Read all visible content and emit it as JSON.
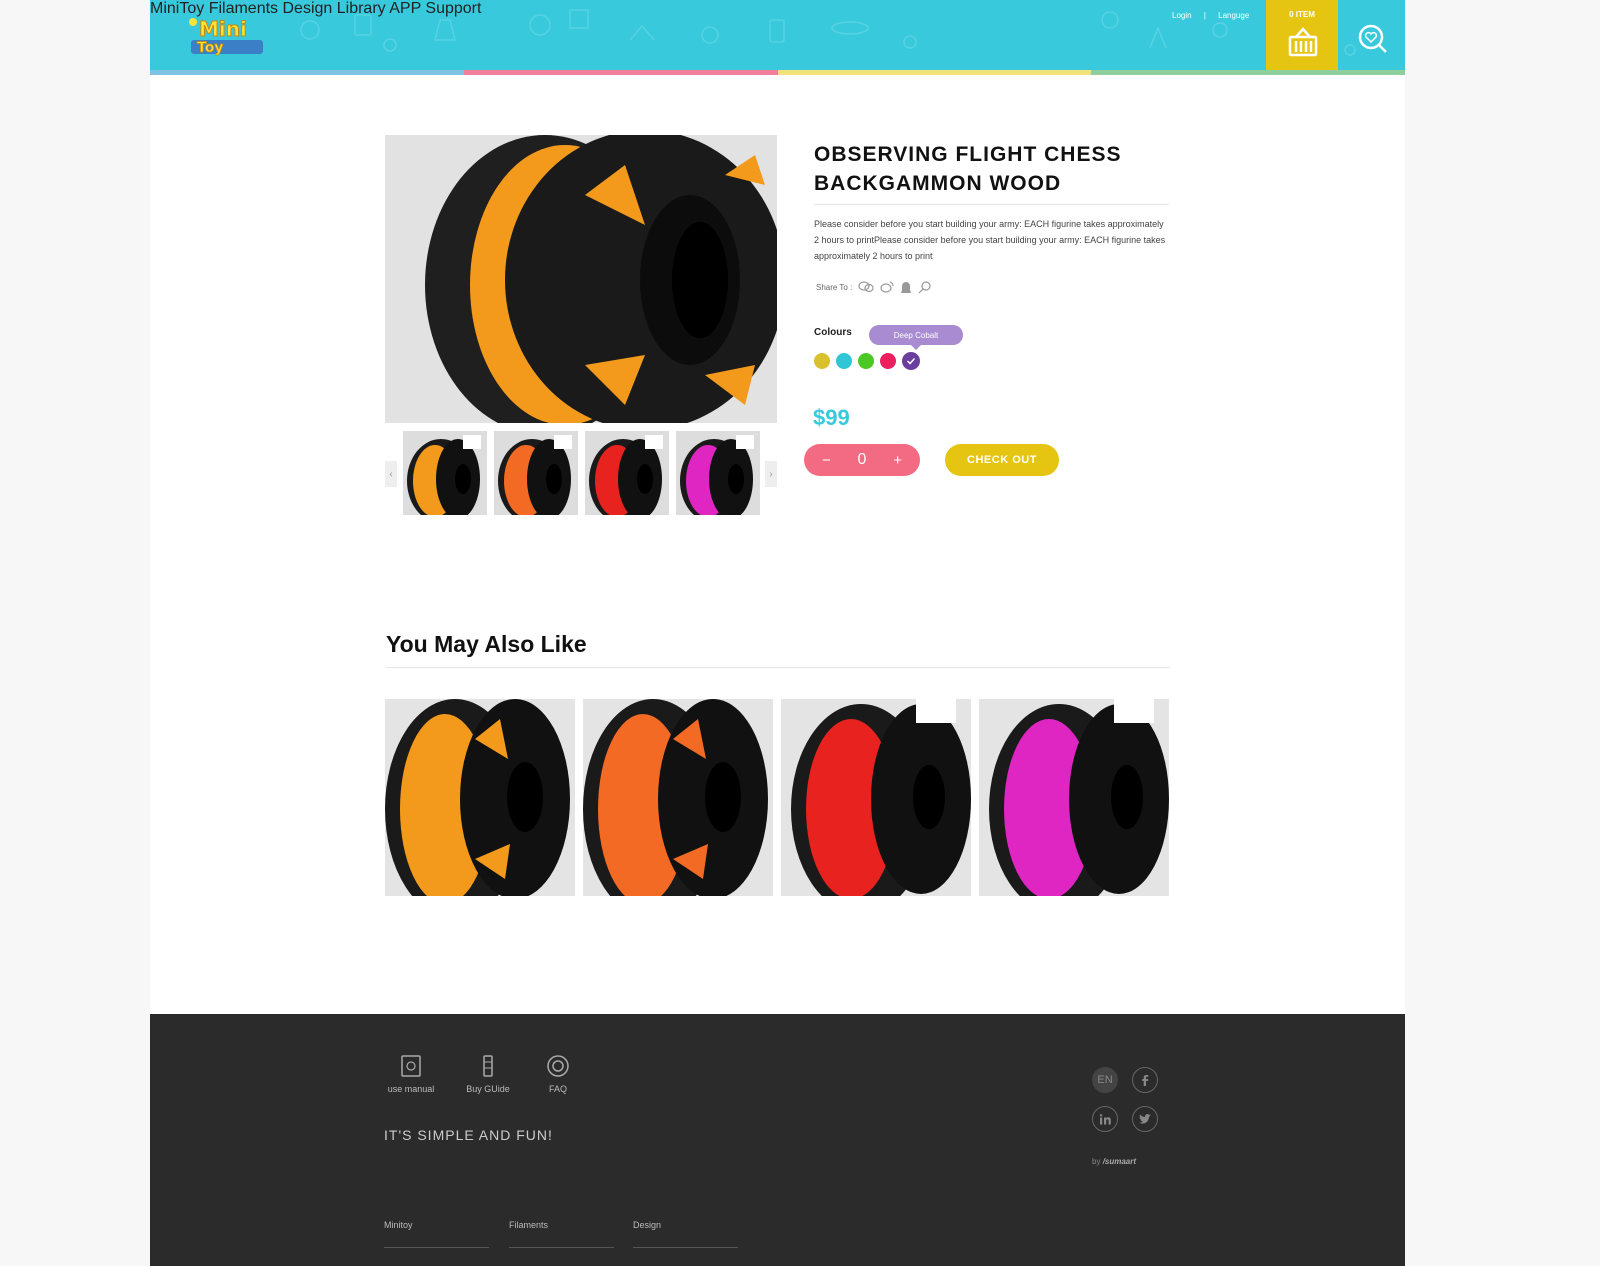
{
  "header": {
    "brand_icon": "minitoy-logo",
    "top_links": {
      "login": "Login",
      "separator": "|",
      "language": "Languge"
    },
    "nav": [
      "MiniToy",
      "Filaments",
      "Design Library",
      "APP",
      "Support"
    ],
    "cart_count": "0 ITEM",
    "cart_icon": "basket-icon",
    "search_icon": "search-icon",
    "stripe_colors": [
      "#7ec3e4",
      "#f07f9c",
      "#f2e27a",
      "#8dcf9d"
    ]
  },
  "product": {
    "title": "OBSERVING FLIGHT CHESS BACKGAMMON WOOD",
    "description": "Please consider before you start building your army: EACH figurine takes approximately 2 hours to printPlease consider before you start building your army: EACH figurine takes approximately 2 hours to print",
    "share_label": "Share To :",
    "share_icons": [
      "wechat-icon",
      "weibo-icon",
      "qq-icon",
      "link-icon"
    ],
    "colours_label": "Colours",
    "selected_colour_name": "Deep Cobalt",
    "colours": [
      "#d9c12e",
      "#2fc6d6",
      "#4cc824",
      "#ec1f5f",
      "#6a3e9e"
    ],
    "price": "$99",
    "quantity": "0",
    "minus": "−",
    "plus": "+",
    "checkout": "CHECK OUT",
    "thumbnails": [
      "#f39a1c",
      "#f36a24",
      "#e8221e",
      "#df25c2"
    ]
  },
  "related": {
    "title": "You May Also Like",
    "items": [
      "#f39a1c",
      "#f36a24",
      "#e8221e",
      "#df25c2"
    ]
  },
  "footer": {
    "icons": [
      {
        "label": "use manual",
        "icon": "manual-icon"
      },
      {
        "label": "Buy GUide",
        "icon": "guide-icon"
      },
      {
        "label": "FAQ",
        "icon": "lifebuoy-icon"
      }
    ],
    "tagline": "IT'S SIMPLE AND FUN!",
    "links": [
      "Minitoy",
      "Filaments",
      "Design"
    ],
    "language": "EN",
    "by": "by",
    "maker": "/sumaart"
  }
}
